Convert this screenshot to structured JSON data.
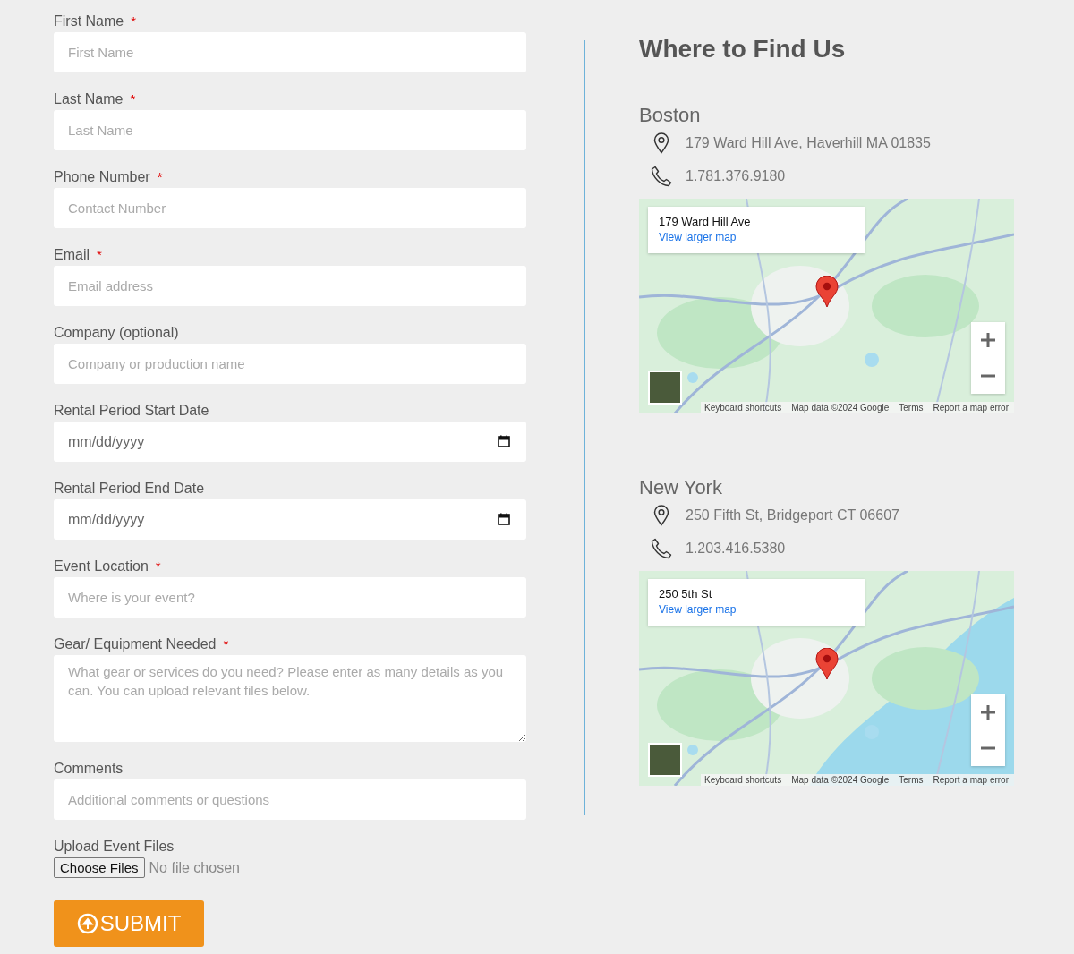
{
  "form": {
    "fields": [
      {
        "kind": "text",
        "label": "First Name",
        "required_mark": "*",
        "placeholder": "First Name"
      },
      {
        "kind": "text",
        "label": "Last Name",
        "required_mark": "*",
        "placeholder": "Last Name"
      },
      {
        "kind": "text",
        "label": "Phone Number",
        "required_mark": "*",
        "placeholder": "Contact Number"
      },
      {
        "kind": "text",
        "label": "Email",
        "required_mark": "*",
        "placeholder": "Email address"
      },
      {
        "kind": "text",
        "label": "Company (optional)",
        "placeholder": "Company or production name"
      },
      {
        "kind": "date",
        "label": "Rental Period Start Date",
        "placeholder": "mm/dd/yyyy"
      },
      {
        "kind": "date",
        "label": "Rental Period End Date",
        "placeholder": "mm/dd/yyyy"
      },
      {
        "kind": "text",
        "label": "Event Location",
        "required_mark": "*",
        "placeholder": "Where is your event?"
      },
      {
        "kind": "textarea",
        "label": "Gear/ Equipment Needed",
        "required_mark": "*",
        "placeholder": "What gear or services do you need? Please enter as many details as you can. You can upload relevant files below."
      },
      {
        "kind": "text",
        "label": "Comments",
        "placeholder": "Additional comments or questions"
      },
      {
        "kind": "file",
        "label": "Upload Event Files",
        "button": "Choose Files",
        "status": "No file chosen"
      }
    ],
    "submit": "SUBMIT"
  },
  "locations": {
    "title": "Where to Find Us",
    "items": [
      {
        "city": "Boston",
        "address": "179 Ward Hill Ave, Haverhill MA 01835",
        "phone": "1.781.376.9180",
        "map": {
          "card_title": "179 Ward Hill Ave",
          "card_link": "View larger map",
          "footer": [
            "Keyboard shortcuts",
            "Map data ©2024 Google",
            "Terms",
            "Report a map error"
          ]
        }
      },
      {
        "city": "New York",
        "address": "250 Fifth St, Bridgeport CT 06607",
        "phone": "1.203.416.5380",
        "map": {
          "card_title": "250 5th St",
          "card_link": "View larger map",
          "footer": [
            "Keyboard shortcuts",
            "Map data ©2024 Google",
            "Terms",
            "Report a map error"
          ]
        }
      }
    ]
  }
}
